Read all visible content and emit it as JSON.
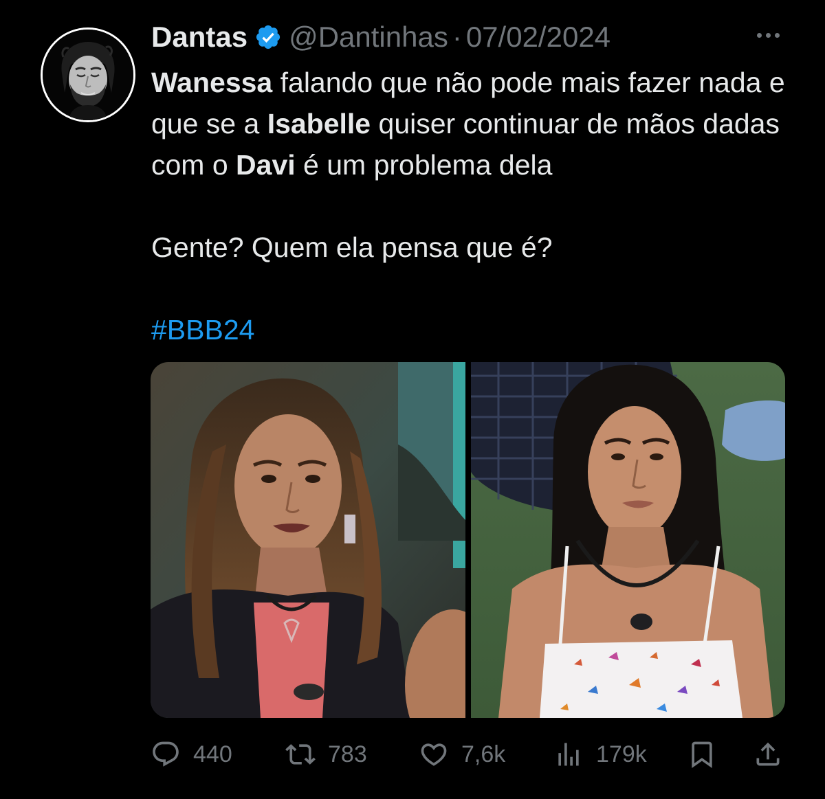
{
  "author": {
    "display_name": "Dantas",
    "handle": "@Dantinhas",
    "separator": "·",
    "date": "07/02/2024",
    "verified_color": "#1d9bf0"
  },
  "tweet": {
    "line1_bold": "Wanessa",
    "line1_rest": " falando que não pode mais fazer nada e que se a ",
    "line1_bold2": "Isabelle",
    "line1_rest2": " quiser continuar de mãos dadas com o ",
    "line1_bold3": "Davi",
    "line1_rest3": " é um problema dela",
    "line2": "Gente? Quem ela pensa que é?",
    "hashtag": "#BBB24"
  },
  "actions": {
    "replies": "440",
    "retweets": "783",
    "likes": "7,6k",
    "views": "179k"
  },
  "icons": {
    "reply": "reply-icon",
    "retweet": "retweet-icon",
    "like": "heart-icon",
    "views": "views-chart-icon",
    "bookmark": "bookmark-icon",
    "share": "share-icon",
    "more": "more-icon",
    "verified": "verified-badge-icon"
  },
  "colors": {
    "background": "#000000",
    "text": "#e7e9ea",
    "muted": "#71767b",
    "link": "#1d9bf0"
  }
}
